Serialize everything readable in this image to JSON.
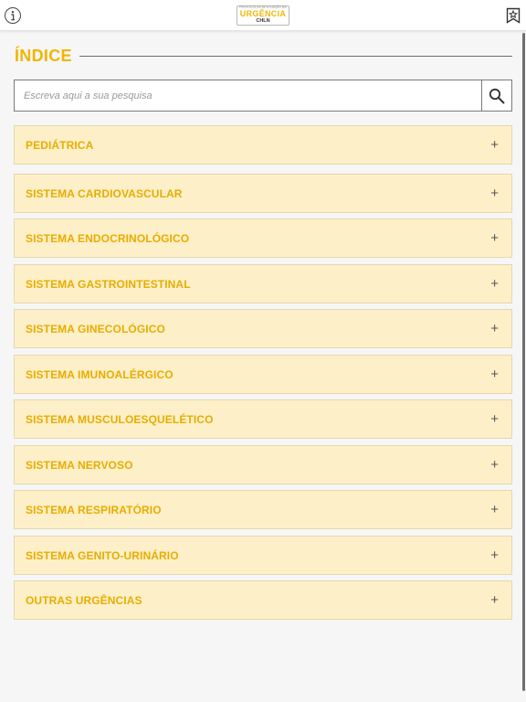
{
  "header": {
    "logo": {
      "line1": "PROTOCOLOS DE ATUAÇÃO NA",
      "line2": "URGÊNCIA",
      "line3": "CHLN"
    },
    "icons": {
      "info": "info-icon",
      "favorites": "bookmark-star-icon"
    }
  },
  "index": {
    "title": "ÍNDICE",
    "search": {
      "placeholder": "Escreva aqui a sua pesquisa",
      "icon": "search-icon"
    },
    "items": [
      {
        "label": "PEDIÁTRICA",
        "icon": "+"
      },
      {
        "label": "SISTEMA CARDIOVASCULAR",
        "icon": "+"
      },
      {
        "label": "SISTEMA ENDOCRINOLÓGICO",
        "icon": "+"
      },
      {
        "label": "SISTEMA GASTROINTESTINAL",
        "icon": "+"
      },
      {
        "label": "SISTEMA GINECOLÓGICO",
        "icon": "+"
      },
      {
        "label": "SISTEMA IMUNOALÉRGICO",
        "icon": "+"
      },
      {
        "label": "SISTEMA MUSCULOESQUELÉTICO",
        "icon": "+"
      },
      {
        "label": "SISTEMA NERVOSO",
        "icon": "+"
      },
      {
        "label": "SISTEMA RESPIRATÓRIO",
        "icon": "+"
      },
      {
        "label": "SISTEMA GENITO-URINÁRIO",
        "icon": "+"
      },
      {
        "label": "OUTRAS URGÊNCIAS",
        "icon": "+"
      }
    ]
  },
  "colors": {
    "accent": "#f2b600",
    "item_bg": "#fdf0c8",
    "item_text": "#e8ac00"
  }
}
